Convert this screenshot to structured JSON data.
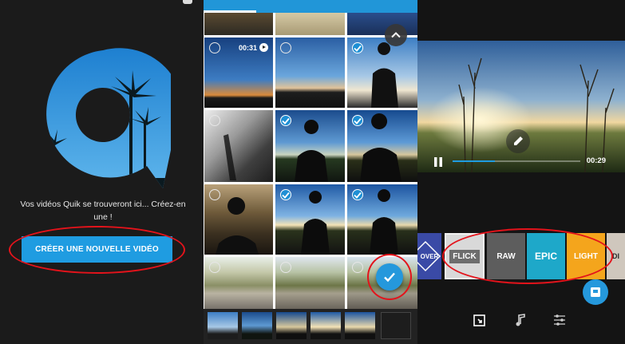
{
  "welcome_screen": {
    "message": "Vos vidéos Quik se trouveront ici... Créez-en une !",
    "create_button_label": "CRÉER UNE NOUVELLE VIDÉO",
    "accent_color": "#1f9ce1"
  },
  "media_picker": {
    "video_duration": "00:31",
    "selected_tiles": [
      3,
      5,
      6,
      8,
      9
    ],
    "icons": [
      "chevron-up-icon",
      "checkmark-icon",
      "play-icon",
      "selection-circle-icon"
    ]
  },
  "editor": {
    "playback_time": "00:29",
    "playback_progress": 0.33,
    "themes": [
      {
        "label": "OVER",
        "color": "#3a4aa6"
      },
      {
        "label": "FLICK",
        "color": "#d9d9d9"
      },
      {
        "label": "RAW",
        "color": "#5d5d5d"
      },
      {
        "label": "EPIC",
        "color": "#1ea8c9"
      },
      {
        "label": "LIGHT",
        "color": "#f4a51c"
      },
      {
        "label": "DI",
        "color": "#cfc7bd"
      }
    ],
    "icons": [
      "pause-icon",
      "pencil-icon",
      "export-icon",
      "music-note-icon",
      "sliders-icon",
      "save-icon"
    ]
  },
  "highlight_color": "#e3131b"
}
